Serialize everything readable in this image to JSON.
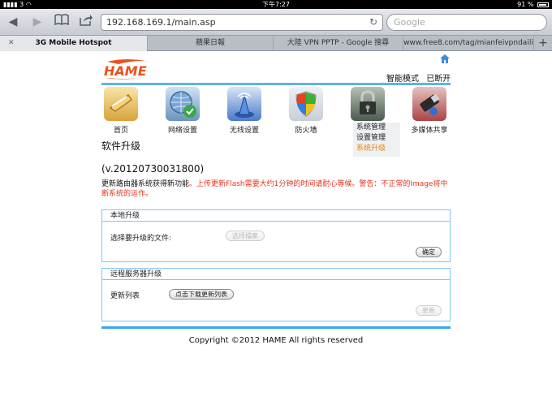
{
  "status": {
    "carrier": "3",
    "time": "下午7:27",
    "battery": "91 %",
    "battery_level": 0.91
  },
  "browser": {
    "url": "192.168.169.1/main.asp",
    "search_placeholder": "Google",
    "tabs": [
      {
        "label": "3G Mobile Hotspot",
        "active": true
      },
      {
        "label": "蘋果日報",
        "active": false
      },
      {
        "label": "大陸 VPN PPTP - Google 搜尋",
        "active": false
      },
      {
        "label": "www.free8.com/tag/mianfeivpndaili",
        "active": false
      }
    ]
  },
  "header": {
    "logo_text": "HAME",
    "mode_label": "智能模式",
    "connection_status": "已断开"
  },
  "nav": {
    "items": [
      {
        "label": "首页",
        "icon": "home-scroll-icon"
      },
      {
        "label": "网络设置",
        "icon": "globe-check-icon"
      },
      {
        "label": "无线设置",
        "icon": "wireless-tower-icon"
      },
      {
        "label": "防火墙",
        "icon": "shield-icon"
      },
      {
        "label": "系统管理",
        "icon": "lock-icon"
      },
      {
        "label": "多媒体共享",
        "icon": "usb-drive-icon"
      }
    ],
    "submenu": [
      "系统管理",
      "设置管理",
      "系统升级"
    ]
  },
  "page": {
    "title": "软件升级",
    "version": "(v.20120730031800)",
    "notice_black": "更新路由器系统获得新功能",
    "notice_red": "。上传更新Flash需要大约1分钟的时间请耐心等候。警告：不正常的Image将中断系统的运作。"
  },
  "local_upgrade": {
    "title": "本地升级",
    "file_label": "选择要升级的文件:",
    "choose_file_button": "选择檔案",
    "confirm_button": "确定"
  },
  "remote_upgrade": {
    "title": "远程服务器升级",
    "list_label": "更新列表",
    "download_button": "点击下载更新列表",
    "update_button": "更新"
  },
  "footer": {
    "copyright": "Copyright ©2012 HAME All rights reserved"
  },
  "colors": {
    "accent_blue": "#5fb3e8",
    "notice_red": "#e8321e",
    "submenu_active": "#e8830f",
    "logo_orange": "#e8521e"
  }
}
